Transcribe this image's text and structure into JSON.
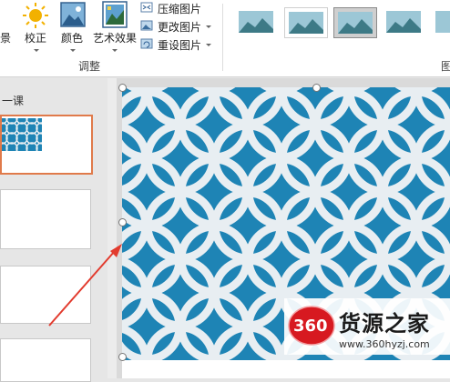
{
  "ribbon": {
    "partial_left_label": "景",
    "buttons": {
      "corrections": "校正",
      "color": "颜色",
      "artistic_effects": "艺术效果"
    },
    "small_buttons": {
      "compress": "压缩图片",
      "change": "更改图片",
      "reset": "重设图片"
    },
    "group_label": "调整",
    "partial_right_label": "图"
  },
  "pane": {
    "label": "一课"
  },
  "watermark": {
    "badge": "360",
    "title": "货源之家",
    "url": "www.360hyzj.com"
  },
  "colors": {
    "pattern_blue": "#1e84b5",
    "pattern_white": "#e8eef2",
    "selection_border": "#e07a4a",
    "annotation_arrow": "#e23b2e",
    "badge_red": "#d71920"
  },
  "icons": [
    "sun-icon",
    "landscape-icon",
    "artistic-effects-icon",
    "compress-icon",
    "change-picture-icon",
    "reset-picture-icon"
  ]
}
